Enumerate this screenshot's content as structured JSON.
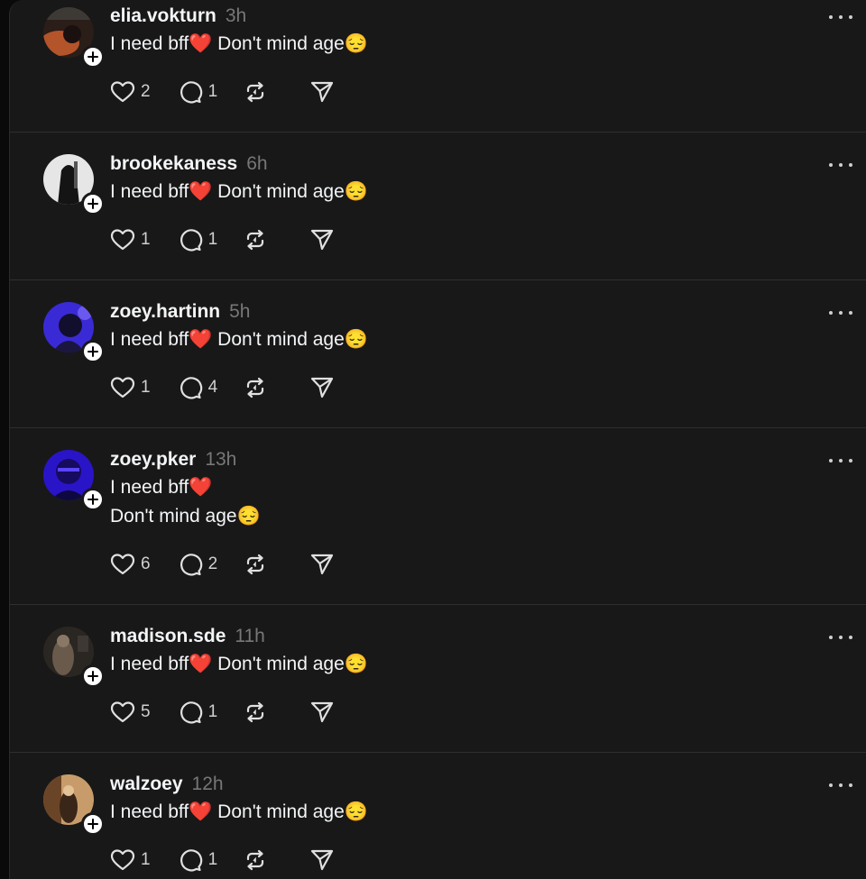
{
  "posts": [
    {
      "username": "elia.vokturn",
      "time": "3h",
      "text": "I need bff❤️ Don't mind age😔",
      "likes": "2",
      "replies": "1",
      "avatar_colors": [
        "#3a2a22",
        "#c0552a",
        "#1a1414"
      ]
    },
    {
      "username": "brookekaness",
      "time": "6h",
      "text": "I need bff❤️ Don't mind age😔",
      "likes": "1",
      "replies": "1",
      "avatar_colors": [
        "#e8e8e8",
        "#111111",
        "#9a9a9a"
      ]
    },
    {
      "username": "zoey.hartinn",
      "time": "5h",
      "text": "I need bff❤️ Don't mind age😔",
      "likes": "1",
      "replies": "4",
      "avatar_colors": [
        "#3b2bd8",
        "#18143a",
        "#7a66ff"
      ]
    },
    {
      "username": "zoey.pker",
      "time": "13h",
      "text": "I need bff❤️\nDon't mind age😔",
      "likes": "6",
      "replies": "2",
      "avatar_colors": [
        "#2b13d0",
        "#140a5a",
        "#5a44ff"
      ]
    },
    {
      "username": "madison.sde",
      "time": "11h",
      "text": "I need bff❤️ Don't mind age😔",
      "likes": "5",
      "replies": "1",
      "avatar_colors": [
        "#2a2622",
        "#8a7a6a",
        "#141210"
      ]
    },
    {
      "username": "walzoey",
      "time": "12h",
      "text": "I need bff❤️ Don't mind age😔",
      "likes": "1",
      "replies": "1",
      "avatar_colors": [
        "#c8a070",
        "#5a3a24",
        "#e8c89a"
      ]
    }
  ],
  "icons": {
    "like": "heart-icon",
    "reply": "comment-icon",
    "repost": "repost-icon",
    "share": "send-icon",
    "more": "more-options-icon",
    "follow": "plus-icon"
  },
  "colors": {
    "background": "#181818",
    "text": "#f3f5f7",
    "muted": "#777777",
    "divider": "#2f2f2f"
  }
}
